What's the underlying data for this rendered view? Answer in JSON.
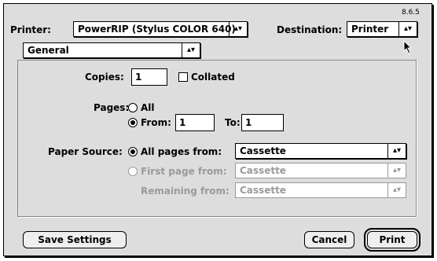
{
  "version": "8.6.5",
  "printer": {
    "label": "Printer:",
    "value": "PowerRIP (Stylus COLOR 640)"
  },
  "destination": {
    "label": "Destination:",
    "value": "Printer"
  },
  "panel": {
    "value": "General"
  },
  "copies": {
    "label": "Copies:",
    "value": "1",
    "collated_label": "Collated"
  },
  "pages": {
    "label": "Pages:",
    "all_label": "All",
    "from_label": "From:",
    "from_value": "1",
    "to_label": "To:",
    "to_value": "1"
  },
  "paper_source": {
    "label": "Paper Source:",
    "all_pages_label": "All pages from:",
    "all_pages_value": "Cassette",
    "first_page_label": "First page from:",
    "first_page_value": "Cassette",
    "remaining_label": "Remaining from:",
    "remaining_value": "Cassette"
  },
  "buttons": {
    "save": "Save Settings",
    "cancel": "Cancel",
    "print": "Print"
  }
}
